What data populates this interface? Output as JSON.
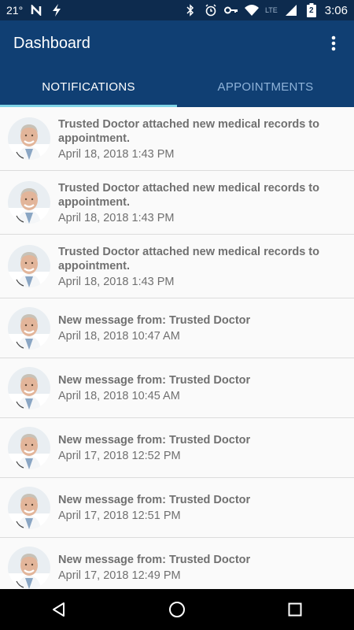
{
  "status_bar": {
    "temperature": "21°",
    "network_label": "LTE",
    "time": "3:06",
    "battery_level": "2",
    "icons": [
      "n-app-icon",
      "lightning-icon",
      "bluetooth-icon",
      "alarm-icon",
      "key-icon",
      "wifi-icon",
      "signal-icon",
      "battery-icon"
    ]
  },
  "app_bar": {
    "title": "Dashboard",
    "overflow_icon": "more-vert-icon"
  },
  "tabs": [
    {
      "label": "NOTIFICATIONS",
      "active": true
    },
    {
      "label": "APPOINTMENTS",
      "active": false
    }
  ],
  "notifications": [
    {
      "title": "Trusted Doctor attached new medical records to appointment.",
      "date": "April 18, 2018 1:43 PM"
    },
    {
      "title": "Trusted Doctor attached new medical records to appointment.",
      "date": "April 18, 2018 1:43 PM"
    },
    {
      "title": "Trusted Doctor attached new medical records to appointment.",
      "date": "April 18, 2018 1:43 PM"
    },
    {
      "title": "New message from: Trusted Doctor",
      "date": "April 18, 2018 10:47 AM"
    },
    {
      "title": "New message from: Trusted Doctor",
      "date": "April 18, 2018 10:45 AM"
    },
    {
      "title": "New message from: Trusted Doctor",
      "date": "April 17, 2018 12:52 PM"
    },
    {
      "title": "New message from: Trusted Doctor",
      "date": "April 17, 2018 12:51 PM"
    },
    {
      "title": "New message from: Trusted Doctor",
      "date": "April 17, 2018 12:49 PM"
    }
  ],
  "nav_bar": {
    "icons": [
      "back-icon",
      "home-icon",
      "recents-icon"
    ]
  },
  "colors": {
    "status_bar": "#0d2b4e",
    "app_bar": "#103f73",
    "tab_indicator": "#7fd3e6",
    "text_gray": "#707070"
  }
}
